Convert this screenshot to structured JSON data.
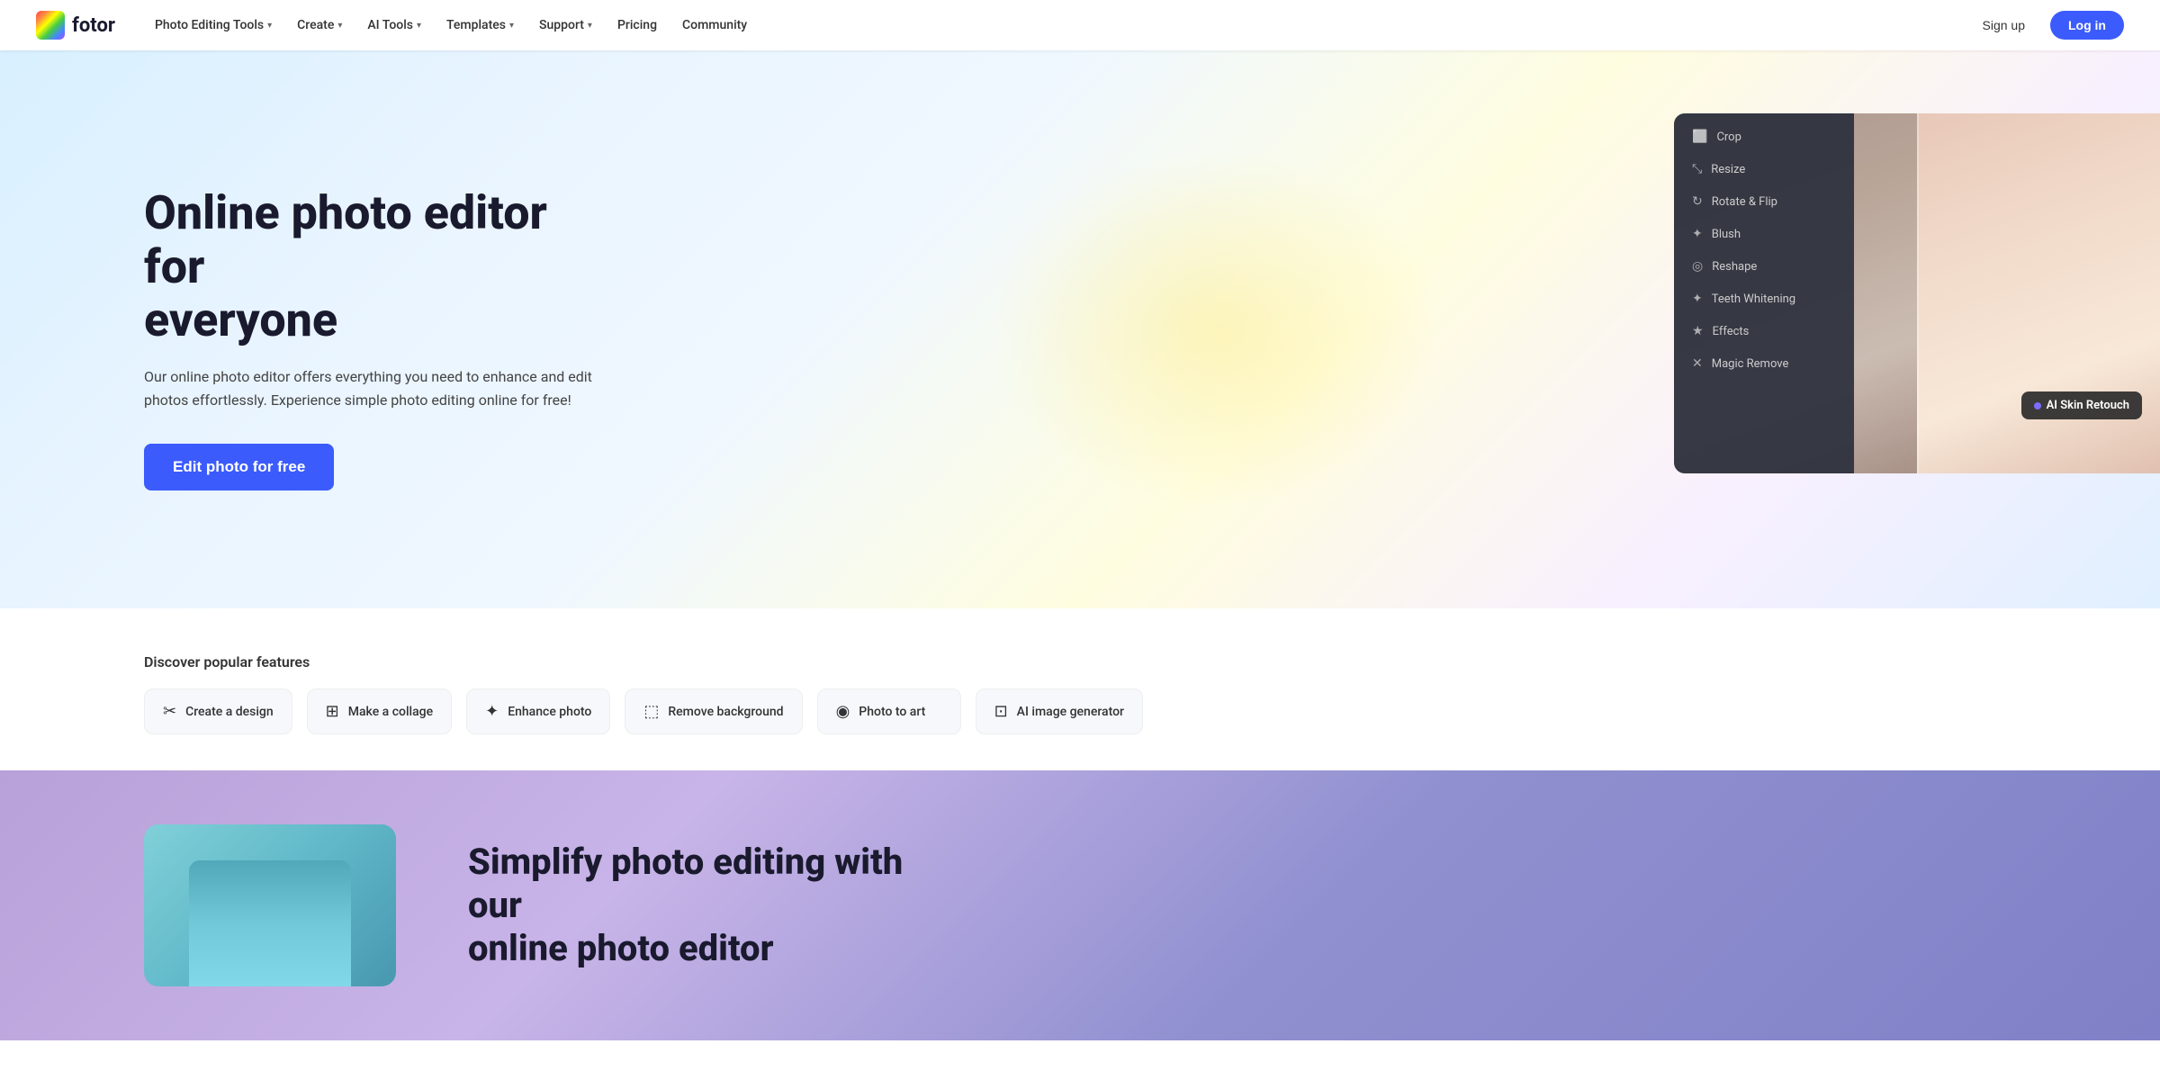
{
  "nav": {
    "logo_text": "fotor",
    "items": [
      {
        "label": "Photo Editing Tools",
        "has_dropdown": true
      },
      {
        "label": "Create",
        "has_dropdown": true
      },
      {
        "label": "AI Tools",
        "has_dropdown": true
      },
      {
        "label": "Templates",
        "has_dropdown": true
      },
      {
        "label": "Support",
        "has_dropdown": true
      },
      {
        "label": "Pricing",
        "has_dropdown": false
      },
      {
        "label": "Community",
        "has_dropdown": false
      }
    ],
    "signin_label": "Sign up",
    "login_label": "Log in"
  },
  "hero": {
    "title_line1": "Online photo editor for",
    "title_line2": "everyone",
    "subtitle": "Our online photo editor offers everything you need to enhance and edit photos effortlessly. Experience simple photo editing online for free!",
    "cta_label": "Edit photo for free",
    "ai_badge_label": "AI Skin Retouch"
  },
  "editor_menu": {
    "items": [
      {
        "icon": "⬜",
        "label": "Crop"
      },
      {
        "icon": "⤡",
        "label": "Resize"
      },
      {
        "icon": "↻",
        "label": "Rotate & Flip"
      },
      {
        "icon": "✦",
        "label": "Blush"
      },
      {
        "icon": "◎",
        "label": "Reshape"
      },
      {
        "icon": "✦",
        "label": "Teeth Whitening"
      },
      {
        "icon": "★",
        "label": "Effects"
      },
      {
        "icon": "✕",
        "label": "Magic Remove"
      }
    ]
  },
  "features": {
    "section_title": "Discover popular features",
    "items": [
      {
        "icon": "✂",
        "label": "Create a design"
      },
      {
        "icon": "⊞",
        "label": "Make a collage"
      },
      {
        "icon": "✦",
        "label": "Enhance photo"
      },
      {
        "icon": "⬚",
        "label": "Remove background"
      },
      {
        "icon": "◉",
        "label": "Photo to art"
      },
      {
        "icon": "⊡",
        "label": "AI image generator"
      }
    ]
  },
  "bottom": {
    "title_line1": "Simplify photo editing with our",
    "title_line2": "online photo editor"
  }
}
